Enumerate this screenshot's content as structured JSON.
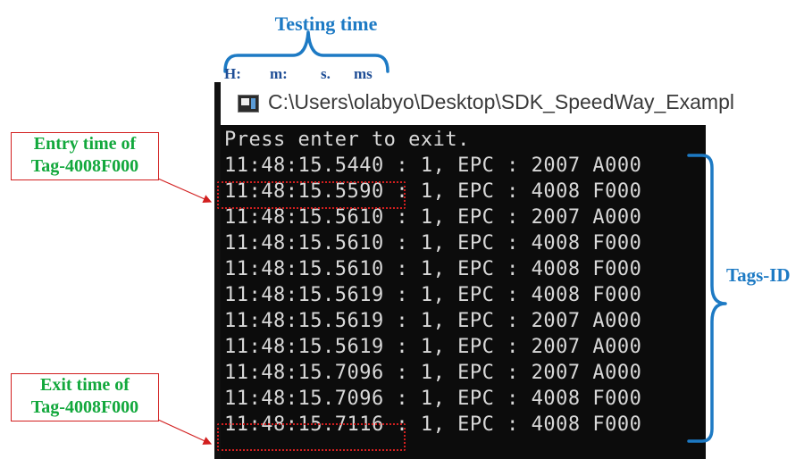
{
  "annotations": {
    "testing_time": "Testing time",
    "time_units": [
      "H:",
      "m:",
      "s.",
      "ms"
    ],
    "entry_time": [
      "Entry time of",
      "Tag-4008F000"
    ],
    "exit_time": [
      "Exit time of",
      "Tag-4008F000"
    ],
    "tags_id": "Tags-ID"
  },
  "window": {
    "title": "C:\\Users\\olabyo\\Desktop\\SDK_SpeedWay_Exampl",
    "icon": "console-app-icon"
  },
  "console": {
    "lines": [
      "Press enter to exit.",
      "11:48:15.5440 : 1, EPC : 2007 A000",
      "11:48:15.5590 : 1, EPC : 4008 F000",
      "11:48:15.5610 : 1, EPC : 2007 A000",
      "11:48:15.5610 : 1, EPC : 4008 F000",
      "11:48:15.5610 : 1, EPC : 4008 F000",
      "11:48:15.5619 : 1, EPC : 4008 F000",
      "11:48:15.5619 : 1, EPC : 2007 A000",
      "11:48:15.5619 : 1, EPC : 2007 A000",
      "11:48:15.7096 : 1, EPC : 2007 A000",
      "11:48:15.7096 : 1, EPC : 4008 F000",
      "11:48:15.7116 : 1, EPC : 4008 F000"
    ]
  },
  "colors": {
    "brace_blue": "#1d7ac4",
    "highlight_red": "#d21f1f",
    "note_green": "#12a83c",
    "console_bg": "#0c0c0c",
    "console_text": "#d8d8d8"
  }
}
